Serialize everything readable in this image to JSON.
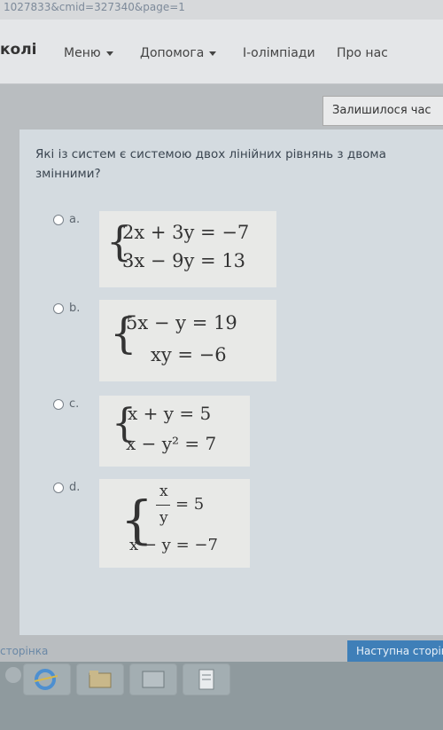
{
  "browser": {
    "url_fragment": "1027833&cmid=327340&page=1"
  },
  "navbar": {
    "site_name": "колі",
    "menu": "Меню",
    "help": "Допомога",
    "olympiads": "І-олімпіади",
    "about": "Про нас"
  },
  "timer_label": "Залишилося час",
  "question": {
    "text": "Які із систем є системою двох лінійних рівнянь з двома змінними?",
    "options": [
      {
        "letter": "a.",
        "eq1": "2x + 3y = −7",
        "eq2": "3x − 9y = 13"
      },
      {
        "letter": "b.",
        "eq1": "5x − y = 19",
        "eq2": "xy = −6"
      },
      {
        "letter": "c.",
        "eq1": "x + y = 5",
        "eq2": "x − y² = 7"
      },
      {
        "letter": "d.",
        "frac_num": "x",
        "frac_den": "y",
        "eq1_rhs": "= 5",
        "eq2": "x − y = −7"
      }
    ]
  },
  "footer": {
    "prev": "сторінка",
    "next": "Наступна сторінка"
  },
  "taskbar": {
    "items": [
      "internet-explorer-icon",
      "file-explorer-icon",
      "window-icon",
      "document-icon",
      "app-icon"
    ]
  }
}
